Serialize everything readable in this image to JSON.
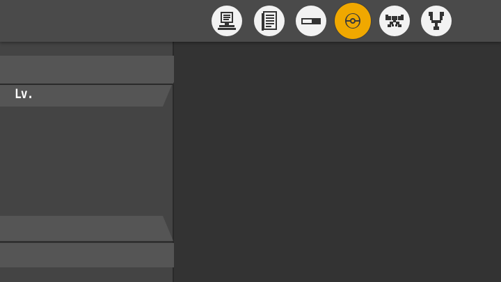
{
  "colors": {
    "accent": "#f0a800",
    "topbar": "#4a4a4a",
    "panel": "#444444",
    "background": "#333333",
    "banner": "#555555",
    "icon_fill": "#f2f2f2",
    "icon_glyph": "#333333"
  },
  "menu": {
    "tabs": [
      {
        "icon": "pc-computer-icon",
        "active": false
      },
      {
        "icon": "notepad-icon",
        "active": false
      },
      {
        "icon": "battery-bar-icon",
        "active": false
      },
      {
        "icon": "pokeball-icon",
        "active": true
      },
      {
        "icon": "bow-tie-icon",
        "active": false
      },
      {
        "icon": "slingshot-fork-icon",
        "active": false
      }
    ]
  },
  "info_panel": {
    "level_label": "Lv."
  }
}
